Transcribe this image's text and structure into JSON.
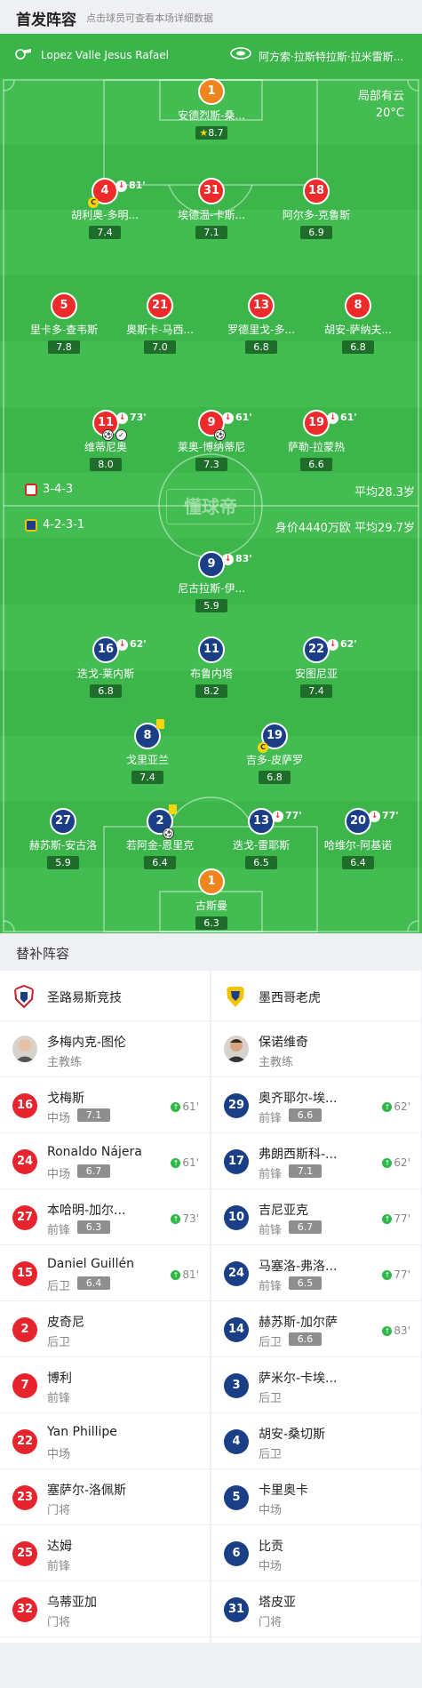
{
  "header": {
    "title": "首发阵容",
    "subtitle": "点击球员可查看本场详细数据"
  },
  "coaches_bar": {
    "home_coach": "Lopez Valle Jesus Rafael",
    "away_coach": "阿方索·拉斯特拉斯·拉米雷斯..."
  },
  "weather": {
    "condition": "局部有云",
    "temp": "20°C"
  },
  "home": {
    "formation": "3-4-3",
    "avg_age": "平均28.3岁",
    "players": [
      {
        "num": "1",
        "name": "安德烈斯-桑...",
        "rating": "8.7",
        "star": true
      },
      {
        "num": "4",
        "name": "胡利奥-多明...",
        "rating": "7.4",
        "sub": "81'",
        "captain": true
      },
      {
        "num": "31",
        "name": "埃德温-卡斯...",
        "rating": "7.1"
      },
      {
        "num": "18",
        "name": "阿尔多-克鲁斯",
        "rating": "6.9"
      },
      {
        "num": "5",
        "name": "里卡多-查韦斯",
        "rating": "7.8"
      },
      {
        "num": "21",
        "name": "奥斯卡-马西...",
        "rating": "7.0"
      },
      {
        "num": "13",
        "name": "罗德里戈-多...",
        "rating": "6.8"
      },
      {
        "num": "8",
        "name": "胡安-萨纳夫...",
        "rating": "6.8"
      },
      {
        "num": "11",
        "name": "维蒂尼奥",
        "rating": "8.0",
        "sub": "73'"
      },
      {
        "num": "9",
        "name": "莱奥-博纳蒂尼",
        "rating": "7.3",
        "sub": "61'"
      },
      {
        "num": "19",
        "name": "萨勒-拉蒙热",
        "rating": "6.6",
        "sub": "61'"
      }
    ]
  },
  "away": {
    "formation": "4-2-3-1",
    "value_age": "身价4440万欧 平均29.7岁",
    "players": [
      {
        "num": "9",
        "name": "尼古拉斯-伊...",
        "rating": "5.9",
        "sub": "83'"
      },
      {
        "num": "16",
        "name": "迭戈-莱内斯",
        "rating": "6.8",
        "sub": "62'"
      },
      {
        "num": "11",
        "name": "布鲁内塔",
        "rating": "8.2"
      },
      {
        "num": "22",
        "name": "安图尼亚",
        "rating": "7.4",
        "sub": "62'"
      },
      {
        "num": "8",
        "name": "戈里亚兰",
        "rating": "7.4"
      },
      {
        "num": "19",
        "name": "吉多-皮萨罗",
        "rating": "6.8",
        "captain": true
      },
      {
        "num": "27",
        "name": "赫苏斯-安古洛",
        "rating": "5.9"
      },
      {
        "num": "2",
        "name": "若阿金-恩里克",
        "rating": "6.4"
      },
      {
        "num": "13",
        "name": "迭戈-雷耶斯",
        "rating": "6.5",
        "sub": "77'"
      },
      {
        "num": "20",
        "name": "哈维尔-阿基诺",
        "rating": "6.4",
        "sub": "77'"
      },
      {
        "num": "1",
        "name": "古斯曼",
        "rating": "6.3"
      }
    ]
  },
  "watermark": "懂球帝",
  "subs_title": "替补阵容",
  "subs_home": {
    "team": "圣路易斯竞技",
    "coach": {
      "name": "多梅内克-图伦",
      "role": "主教练"
    },
    "players": [
      {
        "num": "16",
        "name": "戈梅斯",
        "pos": "中场",
        "rating": "7.1",
        "in": "61'"
      },
      {
        "num": "24",
        "name": "Ronaldo Nájera",
        "pos": "中场",
        "rating": "6.7",
        "in": "61'"
      },
      {
        "num": "27",
        "name": "本哈明-加尔...",
        "pos": "前锋",
        "rating": "6.3",
        "in": "73'"
      },
      {
        "num": "15",
        "name": "Daniel Guillén",
        "pos": "后卫",
        "rating": "6.4",
        "in": "81'"
      },
      {
        "num": "2",
        "name": "皮奇尼",
        "pos": "后卫"
      },
      {
        "num": "7",
        "name": "博利",
        "pos": "前锋"
      },
      {
        "num": "22",
        "name": "Yan Phillipe",
        "pos": "中场"
      },
      {
        "num": "23",
        "name": "塞萨尔-洛佩斯",
        "pos": "门将"
      },
      {
        "num": "25",
        "name": "达姆",
        "pos": "前锋"
      },
      {
        "num": "32",
        "name": "乌蒂亚加",
        "pos": "门将"
      }
    ]
  },
  "subs_away": {
    "team": "墨西哥老虎",
    "coach": {
      "name": "保诺维奇",
      "role": "主教练"
    },
    "players": [
      {
        "num": "29",
        "name": "奥齐耶尔-埃...",
        "pos": "前锋",
        "rating": "6.6",
        "in": "62'"
      },
      {
        "num": "17",
        "name": "弗朗西斯科-...",
        "pos": "前锋",
        "rating": "7.1",
        "in": "62'"
      },
      {
        "num": "10",
        "name": "吉尼亚克",
        "pos": "前锋",
        "rating": "6.7",
        "in": "77'"
      },
      {
        "num": "24",
        "name": "马塞洛-弗洛...",
        "pos": "前锋",
        "rating": "6.5",
        "in": "77'"
      },
      {
        "num": "14",
        "name": "赫苏斯-加尔萨",
        "pos": "后卫",
        "rating": "6.6",
        "in": "83'"
      },
      {
        "num": "3",
        "name": "萨米尔-卡埃...",
        "pos": "后卫"
      },
      {
        "num": "4",
        "name": "胡安-桑切斯",
        "pos": "后卫"
      },
      {
        "num": "5",
        "name": "卡里奥卡",
        "pos": "中场"
      },
      {
        "num": "6",
        "name": "比贡",
        "pos": "中场"
      },
      {
        "num": "31",
        "name": "塔皮亚",
        "pos": "门将"
      }
    ]
  },
  "colors": {
    "pitch": "#3cb64b",
    "home": "#ef2a2a",
    "away": "#1b3f86",
    "goalkeeper": "#f0841d"
  }
}
